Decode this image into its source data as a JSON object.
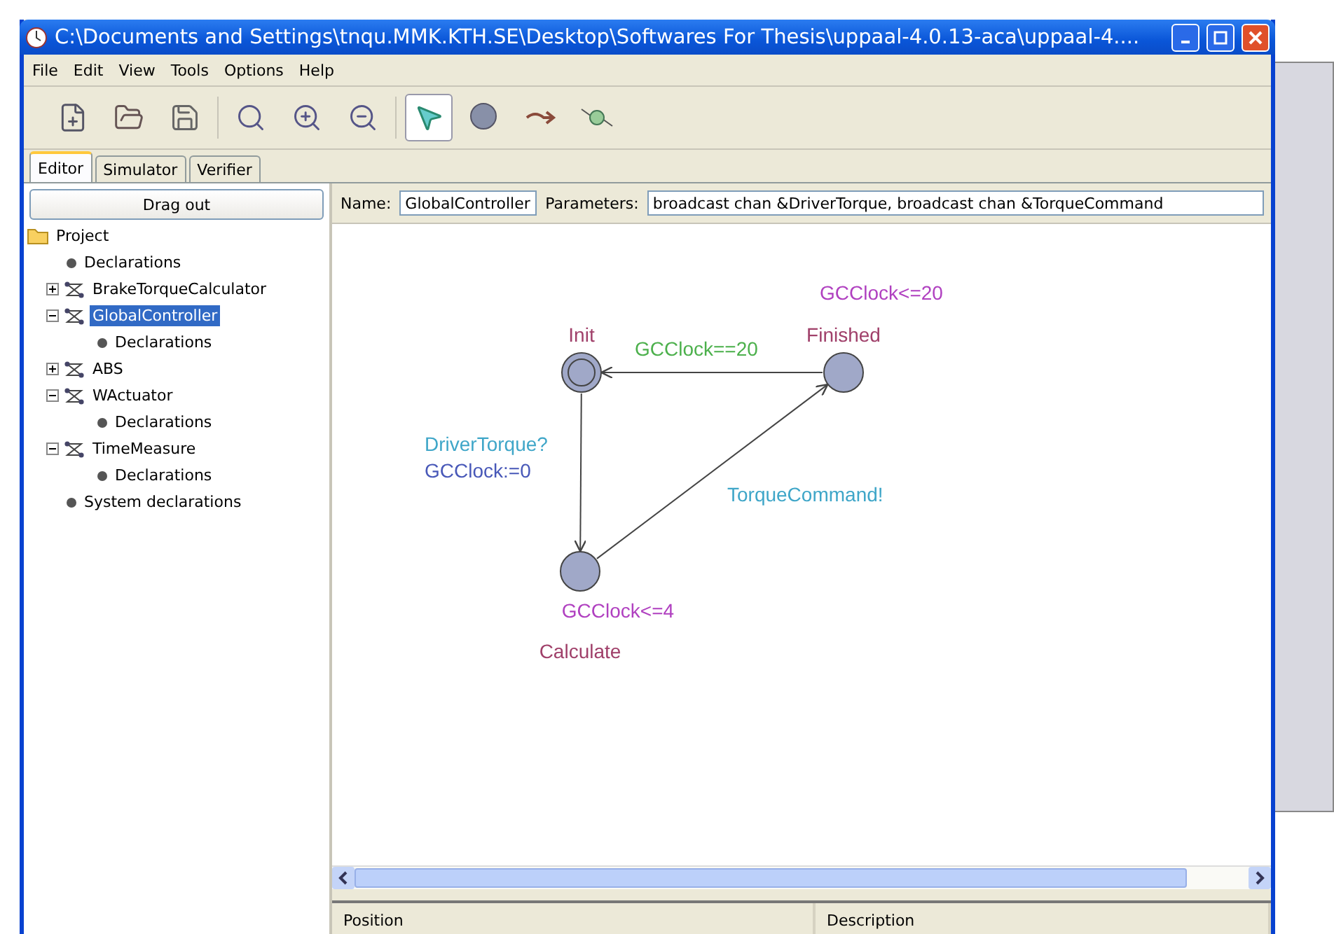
{
  "window": {
    "title": "C:\\Documents and Settings\\tnqu.MMK.KTH.SE\\Desktop\\Softwares For Thesis\\uppaal-4.0.13-aca\\uppaal-4...."
  },
  "menu": [
    "File",
    "Edit",
    "View",
    "Tools",
    "Options",
    "Help"
  ],
  "toolbar": [
    {
      "kind": "new",
      "selected": false
    },
    {
      "kind": "open",
      "selected": false
    },
    {
      "kind": "save",
      "selected": false
    },
    {
      "kind": "zoom",
      "selected": false
    },
    {
      "kind": "zoom_in",
      "selected": false
    },
    {
      "kind": "zoom_out",
      "selected": false
    },
    {
      "kind": "select",
      "selected": true
    },
    {
      "kind": "location",
      "selected": false
    },
    {
      "kind": "edge",
      "selected": false
    },
    {
      "kind": "nail",
      "selected": false
    }
  ],
  "tabs": [
    {
      "label": "Editor",
      "selected": true
    },
    {
      "label": "Simulator",
      "selected": false
    },
    {
      "label": "Verifier",
      "selected": false
    }
  ],
  "drag_out": "Drag out",
  "tree": [
    {
      "label": "Project",
      "kind": "folder",
      "selected": false,
      "children": [
        {
          "label": "Declarations",
          "kind": "declarations",
          "selected": false
        },
        {
          "label": "BrakeTorqueCalculator",
          "kind": "template",
          "expanded": false,
          "selected": false
        },
        {
          "label": "GlobalController",
          "kind": "template",
          "expanded": true,
          "selected": true,
          "children": [
            {
              "label": "Declarations",
              "kind": "declarations",
              "selected": false
            }
          ]
        },
        {
          "label": "ABS",
          "kind": "template",
          "expanded": false,
          "selected": false
        },
        {
          "label": "WActuator",
          "kind": "template",
          "expanded": true,
          "selected": false,
          "children": [
            {
              "label": "Declarations",
              "kind": "declarations",
              "selected": false
            }
          ]
        },
        {
          "label": "TimeMeasure",
          "kind": "template",
          "expanded": true,
          "selected": false,
          "children": [
            {
              "label": "Declarations",
              "kind": "declarations",
              "selected": false
            }
          ]
        },
        {
          "label": "System declarations",
          "kind": "declarations",
          "selected": false
        }
      ]
    }
  ],
  "editor": {
    "name_label": "Name:",
    "name": "GlobalController",
    "parameters_label": "Parameters:",
    "parameters": "broadcast chan &DriverTorque, broadcast chan &TorqueCommand"
  },
  "diagram": {
    "locations": [
      {
        "name": "Init",
        "initial": true
      },
      {
        "name": "Finished",
        "invariant": "GCClock<=20",
        "initial": false
      },
      {
        "name": "Calculate",
        "invariant": "GCClock<=4",
        "initial": false
      }
    ],
    "edges": [
      {
        "labels": [
          {
            "kind": "guard",
            "text": "GCClock==20"
          }
        ]
      },
      {
        "labels": [
          {
            "kind": "sync",
            "text": "DriverTorque?"
          },
          {
            "kind": "update",
            "text": "GCClock:=0"
          }
        ]
      },
      {
        "labels": [
          {
            "kind": "sync",
            "text": "TorqueCommand!"
          }
        ]
      }
    ]
  },
  "table": {
    "columns": [
      "Position",
      "Description"
    ]
  }
}
